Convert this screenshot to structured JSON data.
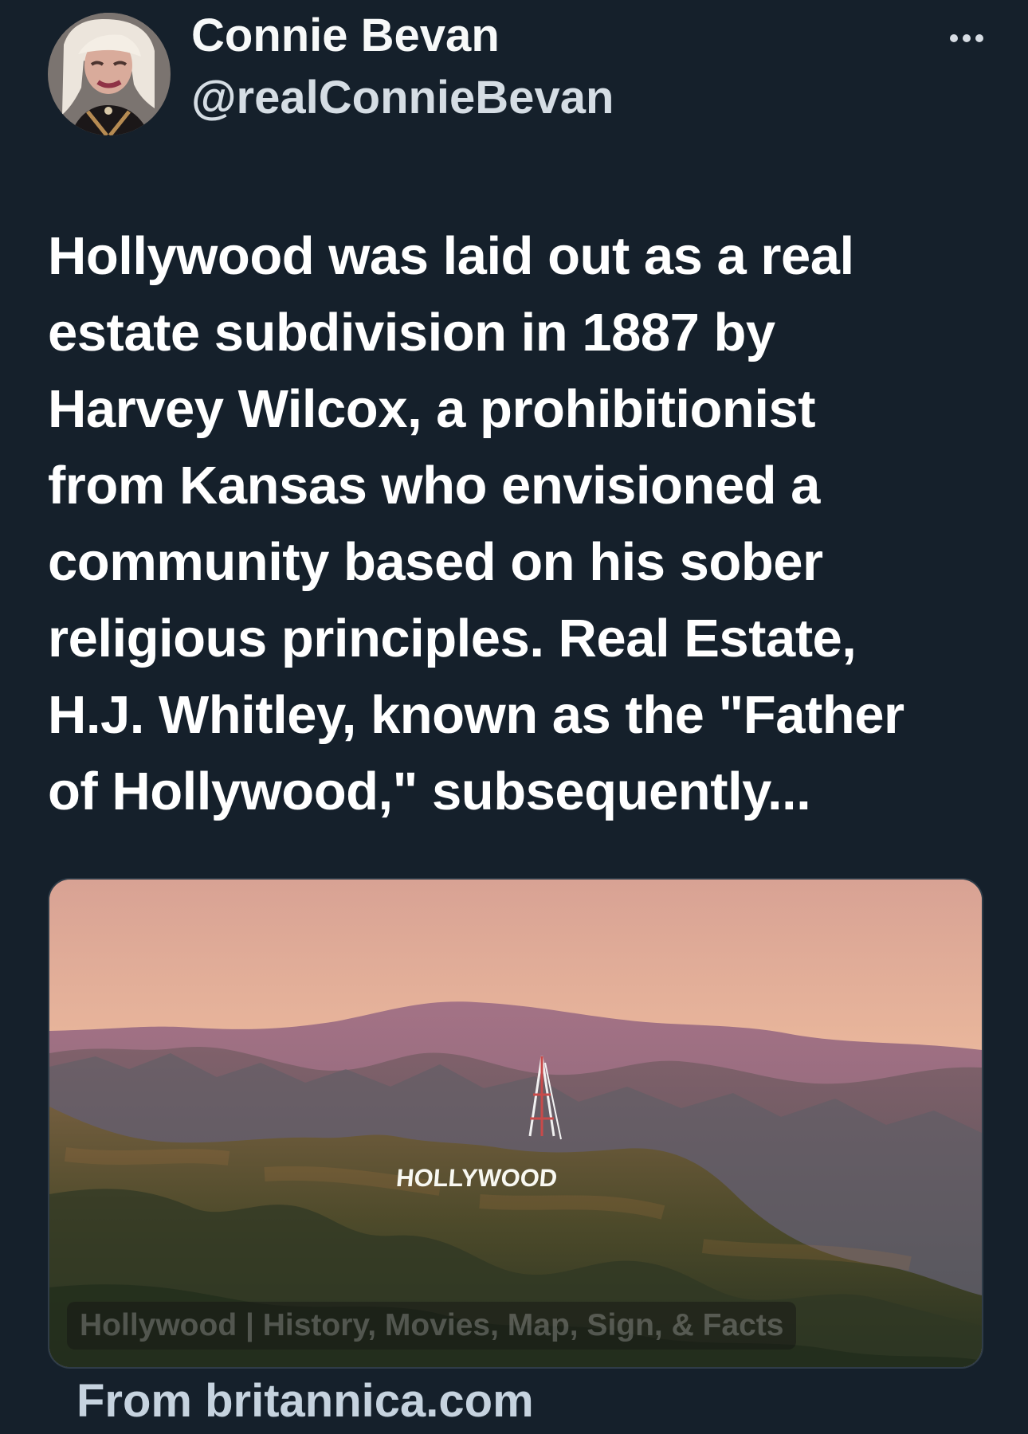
{
  "user": {
    "display_name": "Connie Bevan",
    "handle": "@realConnieBevan"
  },
  "tweet": {
    "lines": [
      "Hollywood was laid out as a real",
      "estate subdivision in 1887 by",
      "Harvey Wilcox, a prohibitionist",
      "from Kansas who envisioned a",
      "community based on his sober",
      "religious principles. Real Estate,",
      "H.J. Whitley, known as the \"Father",
      "of Hollywood,\" subsequently..."
    ]
  },
  "card": {
    "image_title": "Hollywood | History, Movies, Map, Sign, & Facts",
    "sign_text": "HOLLYWOOD",
    "source": "From britannica.com"
  },
  "icons": {
    "more": "more-horizontal-icon"
  },
  "colors": {
    "background": "#15202b",
    "primary_text": "#ffffff",
    "secondary_text": "#c6d3df"
  }
}
